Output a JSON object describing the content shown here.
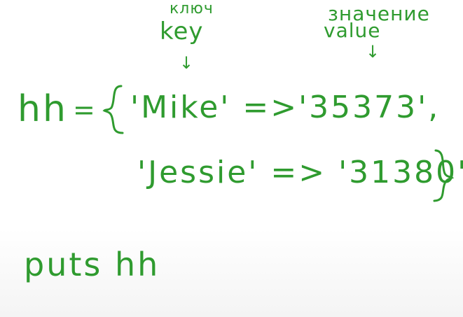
{
  "annotations": {
    "key_ru": "ключ",
    "key_en": "key",
    "value_ru": "значение",
    "value_en": "value"
  },
  "code": {
    "line1_var": "hh",
    "line1_eq": "=",
    "line1_pair": "'Mike' =>'35373',",
    "line2_pair": "'Jessie' => '31380'",
    "line3": "puts hh"
  },
  "colors": {
    "ink": "#2f9b2f",
    "background": "#ffffff"
  }
}
